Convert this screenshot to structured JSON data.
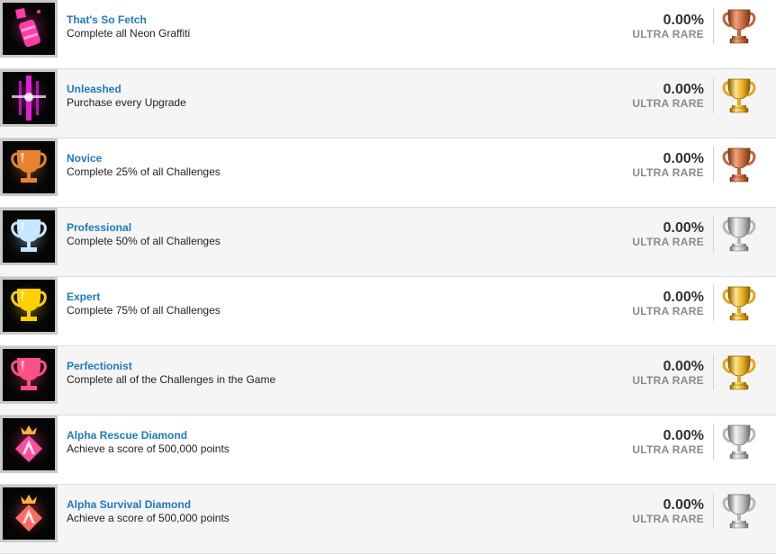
{
  "trophies": [
    {
      "title": "That's So Fetch",
      "description": "Complete all Neon Graffiti",
      "percent": "0.00%",
      "rarity": "ULTRA RARE",
      "grade": "bronze",
      "icon": "neon-spray-can-icon"
    },
    {
      "title": "Unleashed",
      "description": "Purchase every Upgrade",
      "percent": "0.00%",
      "rarity": "ULTRA RARE",
      "grade": "gold",
      "icon": "neon-energy-burst-icon"
    },
    {
      "title": "Novice",
      "description": "Complete 25% of all Challenges",
      "percent": "0.00%",
      "rarity": "ULTRA RARE",
      "grade": "bronze",
      "icon": "bronze-cup-icon"
    },
    {
      "title": "Professional",
      "description": "Complete 50% of all Challenges",
      "percent": "0.00%",
      "rarity": "ULTRA RARE",
      "grade": "silver",
      "icon": "silver-cup-icon"
    },
    {
      "title": "Expert",
      "description": "Complete 75% of all Challenges",
      "percent": "0.00%",
      "rarity": "ULTRA RARE",
      "grade": "gold",
      "icon": "gold-cup-icon"
    },
    {
      "title": "Perfectionist",
      "description": "Complete all of the Challenges in the Game",
      "percent": "0.00%",
      "rarity": "ULTRA RARE",
      "grade": "gold",
      "icon": "pink-cup-icon"
    },
    {
      "title": "Alpha Rescue Diamond",
      "description": "Achieve a score of 500,000 points",
      "percent": "0.00%",
      "rarity": "ULTRA RARE",
      "grade": "silver",
      "icon": "alpha-rescue-badge-icon"
    },
    {
      "title": "Alpha Survival Diamond",
      "description": "Achieve a score of 500,000 points",
      "percent": "0.00%",
      "rarity": "ULTRA RARE",
      "grade": "silver",
      "icon": "alpha-survival-badge-icon"
    }
  ],
  "grade_colors": {
    "bronze": {
      "light": "#f0a47a",
      "mid": "#c2643a",
      "dark": "#7a3518"
    },
    "silver": {
      "light": "#f2f2f2",
      "mid": "#b8b8b8",
      "dark": "#6e6e6e"
    },
    "gold": {
      "light": "#ffe48a",
      "mid": "#e0a81e",
      "dark": "#8c5e00"
    }
  },
  "thumb_colors": {
    "neon-spray-can-icon": "#ff3da8",
    "neon-energy-burst-icon": "#e21fd2",
    "bronze-cup-icon": "#e7822e",
    "silver-cup-icon": "#c8e6ff",
    "gold-cup-icon": "#ffd000",
    "pink-cup-icon": "#ff4f86",
    "alpha-rescue-badge-icon": "#ff4ea0",
    "alpha-survival-badge-icon": "#ff6a64"
  }
}
